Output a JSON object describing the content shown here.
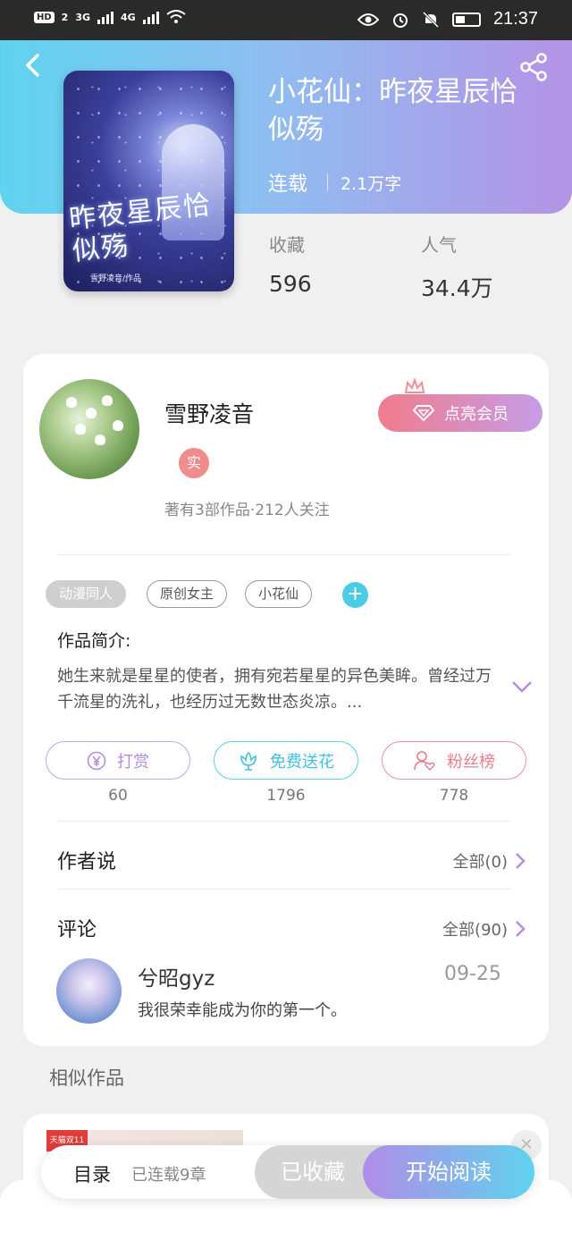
{
  "status_bar": {
    "hd": "HD",
    "sim": "2",
    "net1": "3G",
    "net2": "4G",
    "time": "21:37"
  },
  "book": {
    "title": "小花仙：昨夜星辰恰似殇",
    "status": "连载",
    "word_count": "2.1万字",
    "collect_label": "收藏",
    "collect_value": "596",
    "popularity_label": "人气",
    "popularity_value": "34.4万",
    "cover_title": "昨夜星辰恰似殇",
    "cover_author": "雪野凌音/作品"
  },
  "author": {
    "name": "雪野凌音",
    "badge": "实",
    "info": "著有3部作品·212人关注",
    "vip_button": "点亮会员"
  },
  "tags": [
    "动漫同人",
    "原创女主",
    "小花仙"
  ],
  "intro": {
    "heading": "作品简介:",
    "text": "她生来就是星星的使者，拥有宛若星星的异色美眸。曾经过万千流星的洗礼，也经历过无数世态炎凉。..."
  },
  "actions": {
    "reward": {
      "label": "打赏",
      "count": "60"
    },
    "flower": {
      "label": "免费送花",
      "count": "1796"
    },
    "fans": {
      "label": "粉丝榜",
      "count": "778"
    }
  },
  "author_says": {
    "title": "作者说",
    "more": "全部(0)"
  },
  "comments": {
    "title": "评论",
    "more": "全部(90)",
    "items": [
      {
        "user": "兮昭gyz",
        "date": "09-25",
        "text": "我很荣幸能成为你的第一个。"
      }
    ]
  },
  "similar": {
    "title": "相似作品",
    "ad_badge": "天猫双11"
  },
  "bottom": {
    "toc": "目录",
    "chapters": "已连载9章",
    "collected": "已收藏",
    "read": "开始阅读"
  },
  "colors": {
    "header_start": "#5fd3ee",
    "header_end": "#b493e6",
    "accent_cyan": "#4ccbe6",
    "accent_pink": "#ef8f98",
    "accent_purple": "#c7a3e6"
  }
}
